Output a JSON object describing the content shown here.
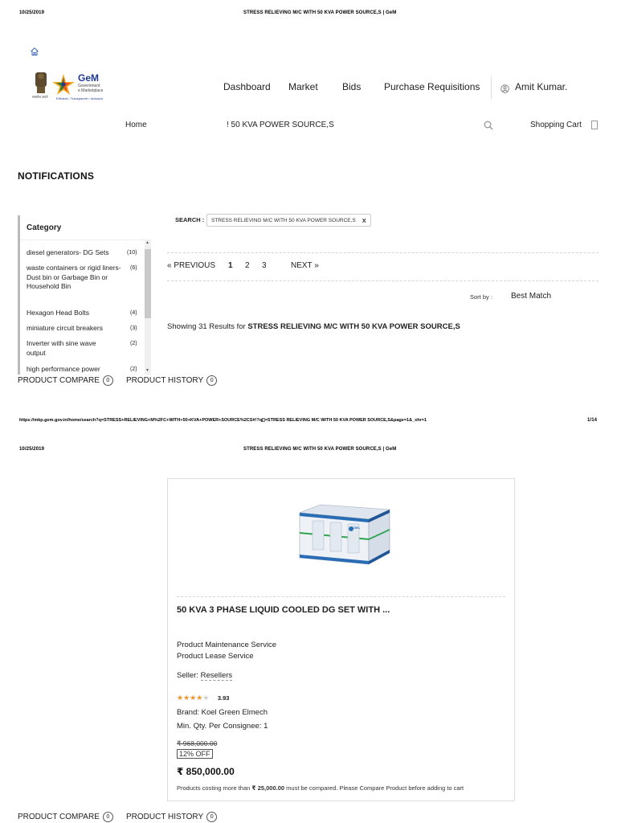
{
  "print_header": {
    "date": "10/25/2019",
    "title": "STRESS RELIEVING M/C WITH 50 KVA POWER SOURCE,S | GeM"
  },
  "header": {
    "logo": {
      "brand": "GeM",
      "line1": "Government",
      "line2": "e Marketplace",
      "tagline": "Efficient • Transparent • Inclusive",
      "emblem_text": "सत्यमेव जयते"
    },
    "nav": [
      "Dashboard",
      "Market",
      "Bids",
      "Purchase Requisitions"
    ],
    "user": "Amit Kumar.",
    "home": "Home",
    "search_value": "! 50 KVA POWER SOURCE,S",
    "cart": "Shopping Cart"
  },
  "notifications_title": "NOTIFICATIONS",
  "category": {
    "title": "Category",
    "items": [
      {
        "label": "diesel generators- DG Sets",
        "count": "(10)"
      },
      {
        "label": "waste containers or rigid liners- Dust bin or Garbage Bin or Household Bin",
        "count": "(6)"
      },
      {
        "label": "Hexagon Head Bolts",
        "count": "(4)"
      },
      {
        "label": "miniature circuit breakers",
        "count": "(3)"
      },
      {
        "label": "Inverter with sine wave output",
        "count": "(2)"
      },
      {
        "label": "high performance power",
        "count": "(2)"
      }
    ]
  },
  "search_filter": {
    "label": "SEARCH :",
    "chip": "STRESS RELIEVING M/C WITH 50 KVA POWER SOURCE,S",
    "chip_close": "X"
  },
  "pagination": {
    "previous": "« PREVIOUS",
    "pages": [
      "1",
      "2",
      "3"
    ],
    "current": "1",
    "next": "NEXT »"
  },
  "sort": {
    "label": "Sort by :",
    "value": "Best Match"
  },
  "results": {
    "prefix": "Showing 31 Results for",
    "query": "STRESS RELIEVING M/C WITH 50 KVA POWER SOURCE,S"
  },
  "footer_bar": {
    "compare_label": "PRODUCT COMPARE",
    "compare_count": "0",
    "history_label": "PRODUCT HISTORY",
    "history_count": "0"
  },
  "print_footer": {
    "url": "https://mkp.gem.gov.in/home/search?q=STRESS+RELIEVING+M%2FC+WITH+50+KVA+POWER+SOURCE%2CS#!?q[]=STRESS RELIEVING M/C WITH 50 KVA POWER SOURCE,S&page=1&_xhr=1",
    "page": "1/14"
  },
  "product": {
    "title": "50 KVA 3 PHASE LIQUID COOLED DG SET WITH ...",
    "services": [
      "Product Maintenance Service",
      "Product Lease Service"
    ],
    "seller_label": "Seller:",
    "seller_value": "Resellers",
    "rating": "3.93",
    "rating_stars": 4,
    "brand": "Brand: Koel Green Elmech",
    "min_qty": "Min. Qty. Per Consignee: 1",
    "mrp": "₹ 968,000.00",
    "off": "12% OFF",
    "price": "₹ 850,000.00",
    "note_prefix": "Products costing more than",
    "note_amount": "₹ 25,000.00",
    "note_suffix": "must be compared. Please Compare Product before adding to cart",
    "image_brand": "KOEL"
  },
  "colors": {
    "star": "#f0932b",
    "generator_body": "#eef2f7",
    "generator_trim": "#2a6db5",
    "generator_stripe": "#2ea44f"
  }
}
